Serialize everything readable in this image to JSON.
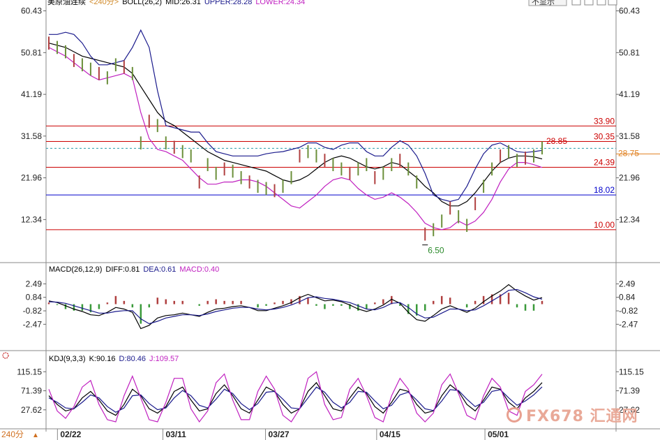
{
  "header": {
    "main": [
      {
        "text": "美原油连续",
        "color": "#000000"
      },
      {
        "text": "<240分>",
        "color": "#d08a2a"
      },
      {
        "text": "BOLL(26,2)",
        "color": "#000000"
      },
      {
        "text": "MID:26.31",
        "color": "#000000"
      },
      {
        "text": "UPPER:28.28",
        "color": "#1a1a8c"
      },
      {
        "text": "LOWER:24.34",
        "color": "#c020c0"
      }
    ],
    "dropdown_label": "不显示"
  },
  "macd_header": [
    {
      "text": "MACD(26,12,9)",
      "color": "#000000"
    },
    {
      "text": "DIFF:0.81",
      "color": "#000000"
    },
    {
      "text": "DEA:0.61",
      "color": "#1a1a8c"
    },
    {
      "text": "MACD:0.40",
      "color": "#c020c0"
    }
  ],
  "kdj_header": [
    {
      "text": "KDJ(9,3,3)",
      "color": "#000000"
    },
    {
      "text": "K:90.16",
      "color": "#000000"
    },
    {
      "text": "D:80.46",
      "color": "#1a1a8c"
    },
    {
      "text": "J:109.57",
      "color": "#c020c0"
    }
  ],
  "period_button": "240分",
  "watermark": "FX678 汇通网",
  "chart_data": [
    {
      "type": "line",
      "name": "price",
      "ytick_labels": [
        "60.43",
        "50.81",
        "41.19",
        "31.58",
        "21.96",
        "12.34"
      ],
      "yticks": [
        60.43,
        50.81,
        41.19,
        31.58,
        21.96,
        12.34
      ],
      "ylim": [
        5,
        61
      ],
      "x_labels": [
        {
          "label": "02/22",
          "pos": 0.02
        },
        {
          "label": "03/11",
          "pos": 0.205
        },
        {
          "label": "03/27",
          "pos": 0.385
        },
        {
          "label": "04/15",
          "pos": 0.58
        },
        {
          "label": "05/01",
          "pos": 0.77
        }
      ],
      "h_levels": [
        {
          "value": 33.9,
          "label": "33.90",
          "color": "#cc0000"
        },
        {
          "value": 30.35,
          "label": "30.35",
          "color": "#cc0000"
        },
        {
          "value": 24.39,
          "label": "24.39",
          "color": "#cc0000"
        },
        {
          "value": 18.02,
          "label": "18.02",
          "color": "#0000cc"
        },
        {
          "value": 10.0,
          "label": "10.00",
          "color": "#cc0000"
        }
      ],
      "last_price": {
        "value": 28.75,
        "label": "28.75",
        "color": "#e08020"
      },
      "annotations": [
        {
          "label": "28.85",
          "value": 28.85,
          "color": "#cc0000"
        },
        {
          "label": "6.50",
          "value": 6.5,
          "color": "#2a8a2a"
        }
      ],
      "series": [
        {
          "name": "MID",
          "color": "#000000",
          "y": [
            53,
            52.5,
            52,
            51,
            50,
            49.5,
            49,
            48.5,
            48,
            47.5,
            46,
            43,
            40,
            37,
            35,
            34,
            32.5,
            31,
            29.5,
            28,
            27,
            26,
            25.5,
            25,
            24.5,
            24,
            23.5,
            22.5,
            21.5,
            21,
            21.5,
            22.5,
            24,
            25.5,
            26.5,
            27,
            26.5,
            25.5,
            24.5,
            24,
            24.5,
            25.5,
            25,
            23.5,
            22,
            20,
            18.5,
            16.5,
            15.5,
            15.5,
            16.5,
            18.5,
            21,
            23.5,
            25.5,
            26.5,
            27,
            27,
            26.8,
            26.31
          ]
        },
        {
          "name": "UPPER",
          "color": "#1a1a8c",
          "y": [
            55,
            55,
            55.5,
            55,
            53,
            50,
            48,
            48,
            48.5,
            49,
            52,
            56,
            52,
            42,
            34,
            33.5,
            33,
            32.5,
            32.5,
            30,
            28,
            27.5,
            27,
            27,
            27,
            27,
            27.5,
            27.8,
            28,
            28.5,
            29,
            30,
            30,
            29,
            28.5,
            29.5,
            30,
            30,
            28,
            27,
            27,
            29,
            30.5,
            29.5,
            27,
            23,
            18,
            17,
            16.5,
            17,
            20,
            24,
            27.5,
            29.5,
            30,
            29,
            28,
            27.8,
            28,
            28.28
          ]
        },
        {
          "name": "LOWER",
          "color": "#c020c0",
          "y": [
            52,
            51,
            50,
            48.5,
            47,
            45.5,
            44.5,
            45,
            45.5,
            46,
            45,
            37,
            31,
            28.5,
            28,
            27,
            26,
            24,
            22,
            20.5,
            20.5,
            21,
            21,
            21.5,
            21.5,
            21,
            20,
            18.5,
            17,
            15.5,
            15,
            16.5,
            18,
            20,
            21.5,
            22,
            21.5,
            19.5,
            18,
            17,
            17.5,
            18.5,
            17.5,
            16,
            14,
            11.5,
            10.5,
            10,
            10.5,
            12,
            11,
            12,
            14,
            17,
            21,
            24,
            25.5,
            25.5,
            25,
            24.34
          ]
        },
        {
          "name": "price",
          "color": "#6b8f3a",
          "y": [
            53,
            52,
            51,
            49,
            48,
            47,
            46,
            45,
            48,
            47.5,
            46,
            30,
            35,
            34,
            30,
            29,
            28,
            27,
            21,
            25,
            23,
            24,
            23.5,
            22,
            21,
            20,
            19.5,
            19,
            20,
            22,
            27,
            28,
            27,
            26,
            25,
            24,
            23,
            24,
            25,
            22,
            23,
            25,
            26,
            24,
            21,
            9,
            10,
            12,
            15,
            13,
            11,
            16,
            20,
            24,
            27,
            28,
            26,
            26.5,
            27,
            28.85
          ]
        }
      ],
      "grid": false
    },
    {
      "type": "bar",
      "name": "MACD",
      "yticks": [
        2.49,
        0.84,
        -0.82,
        -2.47
      ],
      "ytick_labels": [
        "2.49",
        "0.84",
        "-0.82",
        "-2.47"
      ],
      "ylim": [
        -3.3,
        3.3
      ],
      "series": [
        {
          "name": "DIFF",
          "color": "#000000",
          "y": [
            0.4,
            0.2,
            -0.2,
            -0.6,
            -0.9,
            -1.3,
            -1.4,
            -1.0,
            -0.4,
            -0.6,
            -1.0,
            -3.0,
            -2.6,
            -1.7,
            -1.4,
            -1.3,
            -1.1,
            -1.3,
            -1.5,
            -1.0,
            -0.6,
            -0.5,
            -0.3,
            -0.2,
            -0.4,
            -0.8,
            -0.8,
            -0.5,
            -0.2,
            0.2,
            0.8,
            1.2,
            0.8,
            0.4,
            0.5,
            0.3,
            -0.1,
            -0.6,
            -0.9,
            -0.6,
            -0.1,
            0.6,
            0.1,
            -1.0,
            -1.9,
            -2.1,
            -1.4,
            -0.6,
            -0.2,
            -0.6,
            -1.0,
            -0.5,
            0.3,
            1.0,
            1.6,
            2.4,
            1.6,
            1.0,
            0.5,
            0.81
          ]
        },
        {
          "name": "DEA",
          "color": "#1a1a8c",
          "y": [
            0.3,
            0.25,
            0.1,
            -0.2,
            -0.5,
            -0.8,
            -1.1,
            -1.1,
            -0.9,
            -0.8,
            -0.8,
            -1.8,
            -2.4,
            -2.1,
            -1.7,
            -1.5,
            -1.3,
            -1.3,
            -1.4,
            -1.2,
            -0.9,
            -0.7,
            -0.5,
            -0.4,
            -0.4,
            -0.6,
            -0.7,
            -0.6,
            -0.4,
            -0.1,
            0.3,
            0.8,
            0.9,
            0.7,
            0.6,
            0.4,
            0.2,
            -0.2,
            -0.6,
            -0.7,
            -0.4,
            0.1,
            0.2,
            -0.4,
            -1.2,
            -1.7,
            -1.6,
            -1.1,
            -0.6,
            -0.6,
            -0.8,
            -0.7,
            -0.2,
            0.4,
            1.0,
            1.7,
            1.8,
            1.4,
            0.9,
            0.61
          ]
        },
        {
          "name": "MACD",
          "color": "#c020c0",
          "y": [
            0.2,
            -0.1,
            -0.6,
            -0.8,
            -0.8,
            -1.0,
            -0.6,
            0.2,
            1.0,
            0.4,
            -0.4,
            -2.4,
            -0.4,
            0.8,
            0.6,
            0.4,
            0.4,
            0.0,
            -0.2,
            0.4,
            0.6,
            0.4,
            0.4,
            0.4,
            0.0,
            -0.4,
            -0.2,
            0.2,
            0.4,
            0.6,
            1.0,
            0.8,
            -0.2,
            -0.6,
            -0.2,
            -0.2,
            -0.6,
            -0.8,
            -0.6,
            0.2,
            0.6,
            1.0,
            -0.2,
            -1.2,
            -1.4,
            -0.8,
            0.4,
            1.0,
            0.8,
            0.0,
            -0.4,
            0.4,
            1.0,
            1.2,
            1.2,
            1.4,
            -0.4,
            -0.8,
            -0.8,
            0.4
          ]
        }
      ]
    },
    {
      "type": "line",
      "name": "KDJ",
      "yticks": [
        115.15,
        71.39,
        27.62
      ],
      "ytick_labels": [
        "115.15",
        "71.39",
        "27.62"
      ],
      "ylim": [
        0,
        130
      ],
      "series": [
        {
          "name": "K",
          "color": "#000000",
          "y": [
            60,
            40,
            25,
            30,
            55,
            70,
            50,
            25,
            15,
            40,
            75,
            60,
            30,
            20,
            35,
            70,
            80,
            50,
            25,
            30,
            65,
            85,
            60,
            30,
            20,
            50,
            80,
            70,
            40,
            20,
            30,
            70,
            90,
            60,
            30,
            25,
            55,
            80,
            65,
            35,
            20,
            45,
            75,
            70,
            40,
            20,
            25,
            60,
            85,
            70,
            40,
            25,
            50,
            80,
            75,
            45,
            30,
            55,
            70,
            90.16
          ]
        },
        {
          "name": "D",
          "color": "#1a1a8c",
          "y": [
            55,
            45,
            32,
            30,
            45,
            62,
            55,
            35,
            22,
            32,
            60,
            62,
            42,
            28,
            32,
            55,
            72,
            60,
            38,
            32,
            52,
            75,
            65,
            42,
            28,
            42,
            68,
            70,
            52,
            32,
            30,
            55,
            80,
            68,
            45,
            32,
            45,
            70,
            68,
            48,
            30,
            38,
            62,
            68,
            50,
            30,
            26,
            48,
            74,
            72,
            52,
            35,
            45,
            70,
            74,
            55,
            38,
            48,
            62,
            80.46
          ]
        },
        {
          "name": "J",
          "color": "#c020c0",
          "y": [
            75,
            25,
            8,
            35,
            80,
            95,
            40,
            5,
            0,
            60,
            105,
            55,
            5,
            0,
            45,
            100,
            100,
            30,
            0,
            25,
            90,
            110,
            50,
            5,
            5,
            70,
            105,
            75,
            15,
            0,
            30,
            100,
            115,
            40,
            5,
            10,
            75,
            100,
            60,
            10,
            0,
            60,
            100,
            75,
            20,
            0,
            20,
            85,
            110,
            65,
            15,
            5,
            60,
            100,
            80,
            25,
            15,
            70,
            85,
            109.57
          ]
        }
      ]
    }
  ]
}
